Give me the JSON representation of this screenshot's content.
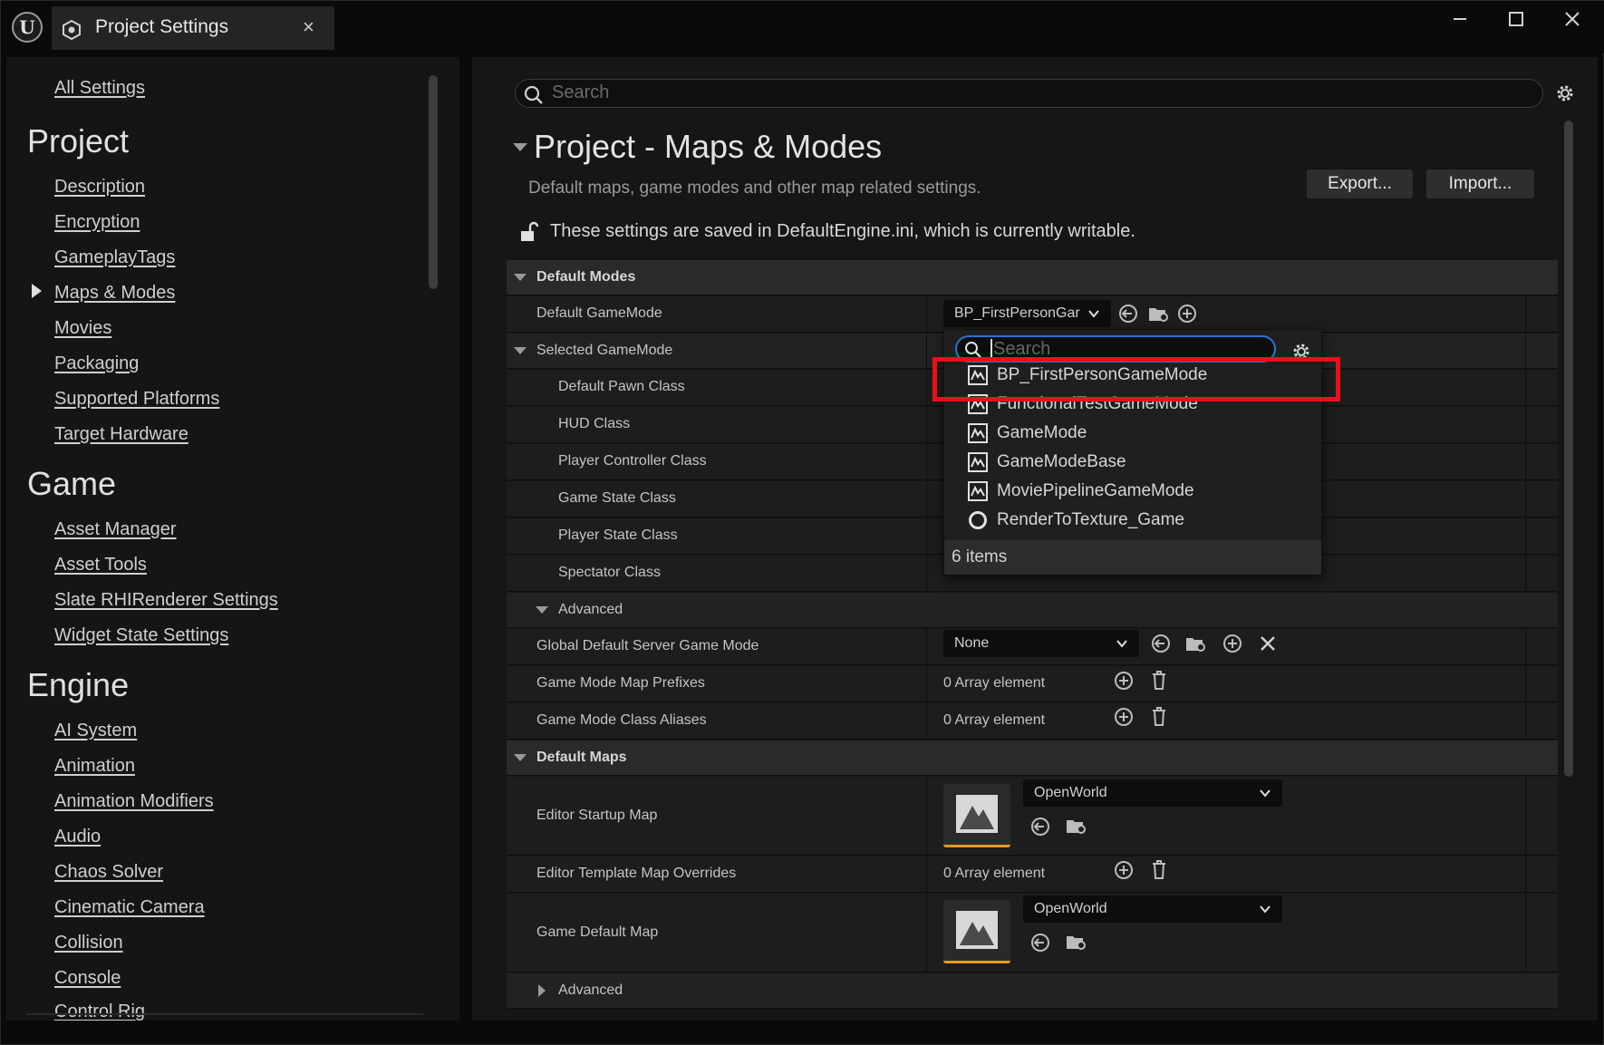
{
  "window": {
    "tab_title": "Project Settings",
    "close_symbol": "×",
    "minimize_symbol": "—",
    "maximize_symbol": "☐",
    "close_window_symbol": "✕"
  },
  "nav": {
    "all_settings": "All Settings",
    "sections": [
      {
        "title": "Project",
        "items": [
          "Description",
          "Encryption",
          "GameplayTags",
          "Maps & Modes",
          "Movies",
          "Packaging",
          "Supported Platforms",
          "Target Hardware"
        ]
      },
      {
        "title": "Game",
        "items": [
          "Asset Manager",
          "Asset Tools",
          "Slate RHIRenderer Settings",
          "Widget State Settings"
        ]
      },
      {
        "title": "Engine",
        "items": [
          "AI System",
          "Animation",
          "Animation Modifiers",
          "Audio",
          "Chaos Solver",
          "Cinematic Camera",
          "Collision",
          "Console",
          "Control Rig"
        ]
      }
    ],
    "selected_item": "Maps & Modes"
  },
  "search": {
    "placeholder": "Search"
  },
  "header": {
    "title": "Project - Maps & Modes",
    "description": "Default maps, game modes and other map related settings.",
    "export_label": "Export...",
    "import_label": "Import...",
    "writable_note": "These settings are saved in DefaultEngine.ini, which is currently writable."
  },
  "grid": {
    "default_modes": "Default Modes",
    "default_gamemode_label": "Default GameMode",
    "default_gamemode_value": "BP_FirstPersonGar",
    "selected_gamemode": "Selected GameMode",
    "default_pawn_class": "Default Pawn Class",
    "hud_class": "HUD Class",
    "player_controller_class": "Player Controller Class",
    "game_state_class": "Game State Class",
    "player_state_class": "Player State Class",
    "spectator_class": "Spectator Class",
    "advanced": "Advanced",
    "global_default_server_game_mode": "Global Default Server Game Mode",
    "global_default_server_value": "None",
    "game_mode_map_prefixes": "Game Mode Map Prefixes",
    "game_mode_class_aliases": "Game Mode Class Aliases",
    "array_element": "0 Array element",
    "default_maps": "Default Maps",
    "editor_startup_map": "Editor Startup Map",
    "editor_startup_value": "OpenWorld",
    "editor_template_map_overrides": "Editor Template Map Overrides",
    "game_default_map": "Game Default Map",
    "game_default_value": "OpenWorld",
    "advanced2": "Advanced"
  },
  "popup": {
    "search_placeholder": "Search",
    "items": [
      "BP_FirstPersonGameMode",
      "FunctionalTestGameMode",
      "GameMode",
      "GameModeBase",
      "MoviePipelineGameMode",
      "RenderToTexture_Game"
    ],
    "item_icons": [
      "gamemode-blueprint-icon",
      "gamemode-blueprint-icon",
      "gamemode-blueprint-icon",
      "gamemode-blueprint-icon",
      "gamemode-blueprint-icon",
      "circle-asset-icon"
    ],
    "count": "6 items",
    "highlighted_item": "BP_FirstPersonGameMode",
    "highlight_color": "#e8101c"
  },
  "colors": {
    "accent_blue": "#2a74d1",
    "thumbnail_underline": "#e89a1c"
  }
}
